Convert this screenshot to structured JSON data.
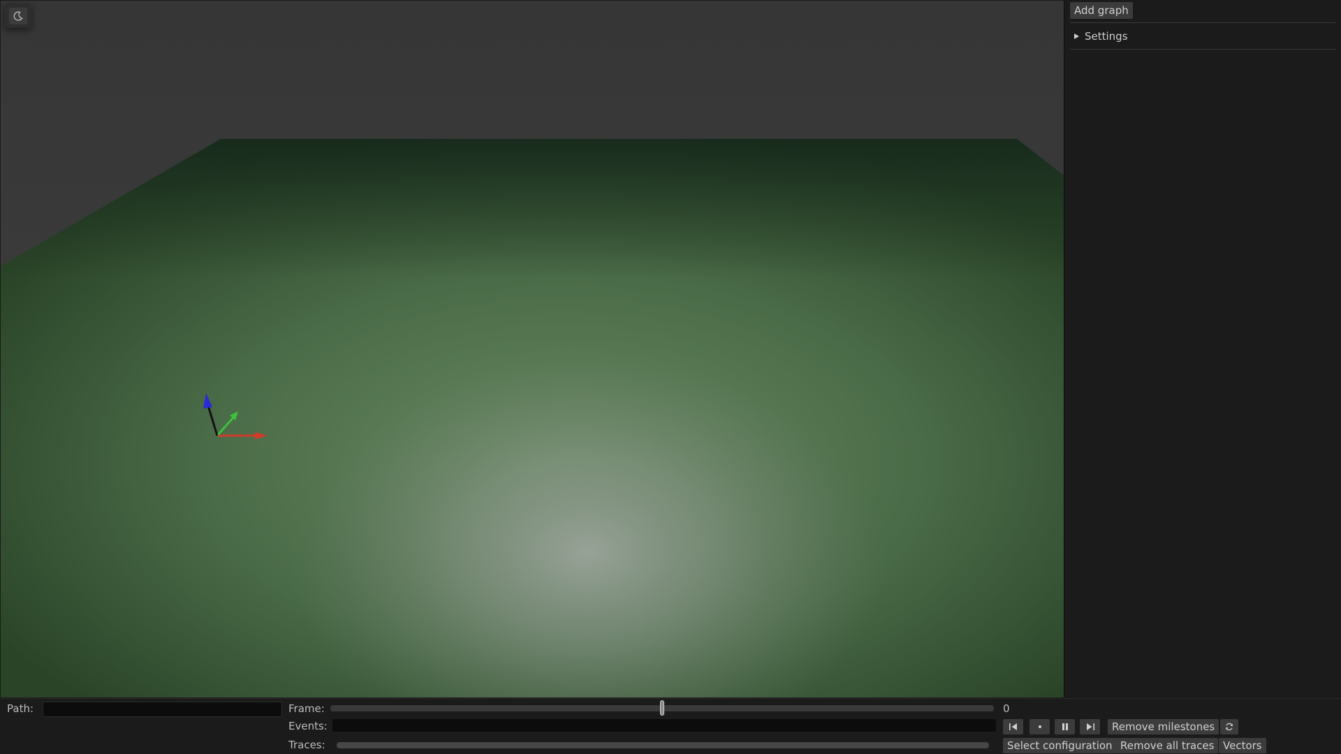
{
  "theme_toggle": {
    "icon": "moon-icon"
  },
  "sidebar": {
    "add_graph_label": "Add graph",
    "settings_label": "Settings"
  },
  "bottom": {
    "path_label": "Path:",
    "path_value": "",
    "frame_label": "Frame:",
    "frame_value": "0",
    "events_label": "Events:",
    "traces_label": "Traces:",
    "playback": {
      "prev_icon": "skip-back-icon",
      "milestone_icon": "milestone-dot-icon",
      "pause_icon": "pause-icon",
      "next_icon": "skip-forward-icon"
    },
    "remove_milestones_label": "Remove milestones",
    "refresh_icon": "refresh-icon",
    "select_configuration_label": "Select configuration",
    "remove_all_traces_label": "Remove all traces",
    "vectors_label": "Vectors"
  },
  "colors": {
    "x_axis": "#d23a2a",
    "y_axis": "#3cc23c",
    "z_axis": "#2a2ad6",
    "ground": "#4a6e4a",
    "sky": "#3a3a3a"
  }
}
